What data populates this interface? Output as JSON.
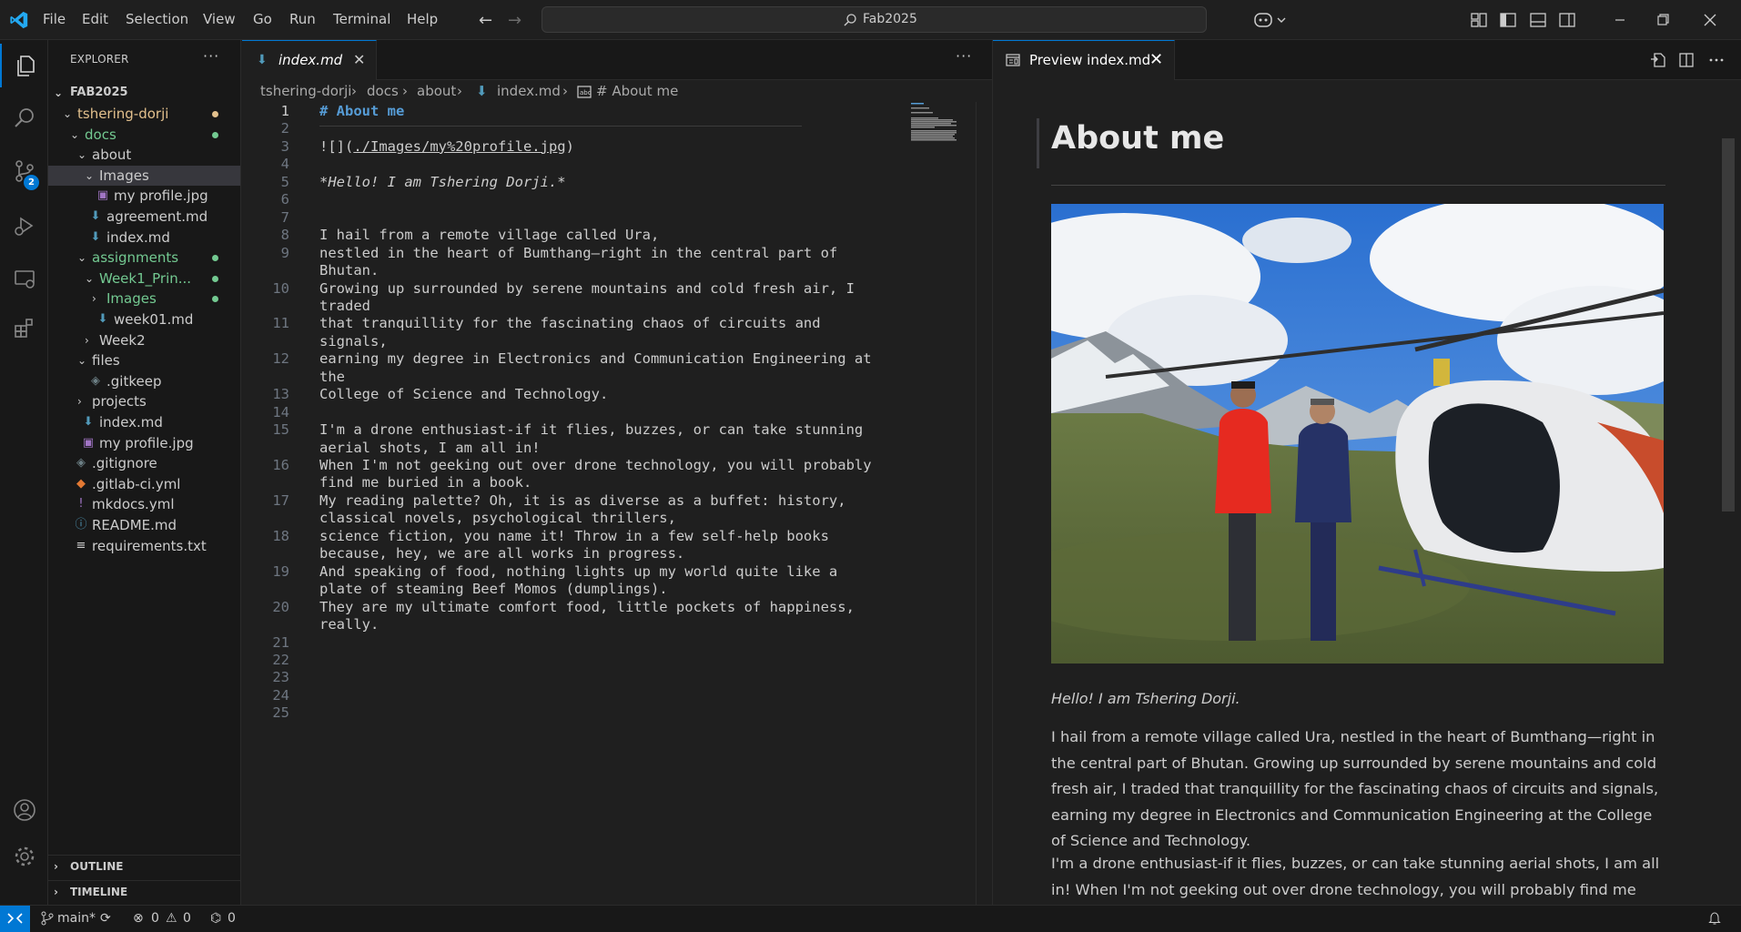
{
  "menu": [
    "File",
    "Edit",
    "Selection",
    "View",
    "Go",
    "Run",
    "Terminal",
    "Help"
  ],
  "command_center": {
    "label": "Fab2025",
    "icon": "search-icon"
  },
  "sidebar": {
    "title": "EXPLORER",
    "root": "FAB2025",
    "tree": [
      {
        "label": "tshering-dorji",
        "type": "folder",
        "open": true,
        "depth": 1,
        "git": "modified"
      },
      {
        "label": "docs",
        "type": "folder",
        "open": true,
        "depth": 2,
        "git": "added"
      },
      {
        "label": "about",
        "type": "folder",
        "open": true,
        "depth": 3
      },
      {
        "label": "Images",
        "type": "folder",
        "open": true,
        "depth": 4,
        "selected": true
      },
      {
        "label": "my profile.jpg",
        "type": "image",
        "depth": 5
      },
      {
        "label": "agreement.md",
        "type": "markdown",
        "depth": 4
      },
      {
        "label": "index.md",
        "type": "markdown",
        "depth": 4
      },
      {
        "label": "assignments",
        "type": "folder",
        "open": true,
        "depth": 3,
        "git": "added"
      },
      {
        "label": "Week1_Prin...",
        "type": "folder",
        "open": true,
        "depth": 4,
        "git": "added"
      },
      {
        "label": "Images",
        "type": "folder",
        "open": false,
        "depth": 5,
        "git": "added"
      },
      {
        "label": "week01.md",
        "type": "markdown",
        "depth": 5
      },
      {
        "label": "Week2",
        "type": "folder",
        "open": false,
        "depth": 4
      },
      {
        "label": "files",
        "type": "folder",
        "open": true,
        "depth": 3
      },
      {
        "label": ".gitkeep",
        "type": "git",
        "depth": 4
      },
      {
        "label": "projects",
        "type": "folder",
        "open": false,
        "depth": 3
      },
      {
        "label": "index.md",
        "type": "markdown",
        "depth": 3
      },
      {
        "label": "my profile.jpg",
        "type": "image",
        "depth": 3
      },
      {
        "label": ".gitignore",
        "type": "git",
        "depth": 2
      },
      {
        "label": ".gitlab-ci.yml",
        "type": "gitlab",
        "depth": 2
      },
      {
        "label": "mkdocs.yml",
        "type": "yaml",
        "depth": 2
      },
      {
        "label": "README.md",
        "type": "info",
        "depth": 2
      },
      {
        "label": "requirements.txt",
        "type": "text",
        "depth": 2
      }
    ],
    "outline": "OUTLINE",
    "timeline": "TIMELINE"
  },
  "editor": {
    "tab_label": "index.md",
    "breadcrumb": [
      "tshering-dorji",
      "docs",
      "about",
      "index.md",
      "# About me"
    ],
    "lines": [
      {
        "n": "1",
        "text": "# About me",
        "style": "heading"
      },
      {
        "n": "2",
        "text": ""
      },
      {
        "n": "3",
        "text": "![](./Images/my%20profile.jpg)",
        "style": "link"
      },
      {
        "n": "4",
        "text": ""
      },
      {
        "n": "5",
        "text": "*Hello! I am Tshering Dorji.*",
        "style": "italic"
      },
      {
        "n": "6",
        "text": ""
      },
      {
        "n": "7",
        "text": ""
      },
      {
        "n": "8",
        "text": "I hail from a remote village called Ura,"
      },
      {
        "n": "9",
        "text": "nestled in the heart of Bumthang—right in the central part of"
      },
      {
        "n": "",
        "text": "Bhutan."
      },
      {
        "n": "10",
        "text": "Growing up surrounded by serene mountains and cold fresh air, I"
      },
      {
        "n": "",
        "text": "traded"
      },
      {
        "n": "11",
        "text": "that tranquillity for the fascinating chaos of circuits and"
      },
      {
        "n": "",
        "text": "signals,"
      },
      {
        "n": "12",
        "text": "earning my degree in Electronics and Communication Engineering at"
      },
      {
        "n": "",
        "text": "the"
      },
      {
        "n": "13",
        "text": "College of Science and Technology."
      },
      {
        "n": "14",
        "text": ""
      },
      {
        "n": "15",
        "text": "I'm a drone enthusiast-if it flies, buzzes, or can take stunning"
      },
      {
        "n": "",
        "text": "aerial shots, I am all in!"
      },
      {
        "n": "16",
        "text": "When I'm not geeking out over drone technology, you will probably"
      },
      {
        "n": "",
        "text": "find me buried in a book."
      },
      {
        "n": "17",
        "text": "My reading palette? Oh, it is as diverse as a buffet: history,"
      },
      {
        "n": "",
        "text": "classical novels, psychological thrillers,"
      },
      {
        "n": "18",
        "text": "science fiction, you name it! Throw in a few self-help books"
      },
      {
        "n": "",
        "text": "because, hey, we are all works in progress."
      },
      {
        "n": "19",
        "text": "And speaking of food, nothing lights up my world quite like a"
      },
      {
        "n": "",
        "text": "plate of steaming Beef Momos (dumplings)."
      },
      {
        "n": "20",
        "text": "They are my ultimate comfort food, little pockets of happiness,"
      },
      {
        "n": "",
        "text": "really."
      },
      {
        "n": "21",
        "text": ""
      },
      {
        "n": "22",
        "text": ""
      },
      {
        "n": "23",
        "text": ""
      },
      {
        "n": "24",
        "text": ""
      },
      {
        "n": "25",
        "text": ""
      }
    ]
  },
  "preview": {
    "tab_label": "Preview index.md",
    "heading": "About me",
    "greeting": "Hello! I am Tshering Dorji.",
    "paragraphs": [
      "I hail from a remote village called Ura, nestled in the heart of Bumthang—right in the central part of Bhutan. Growing up surrounded by serene mountains and cold fresh air, I traded that tranquillity for the fascinating chaos of circuits and signals, earning my degree in Electronics and Communication Engineering at the College of Science and Technology.",
      "I'm a drone enthusiast-if it flies, buzzes, or can take stunning aerial shots, I am all in! When I'm not geeking out over drone technology, you will probably find me buried in a book. My reading palette? Oh, it is as diverse as a buffet: history, classical novels,"
    ]
  },
  "statusbar": {
    "branch": "main*",
    "errors": "0",
    "warnings": "0",
    "ports": "0"
  },
  "colors": {
    "accent": "#0078d4",
    "git_added": "#73c991",
    "git_modified": "#e2c08d"
  }
}
